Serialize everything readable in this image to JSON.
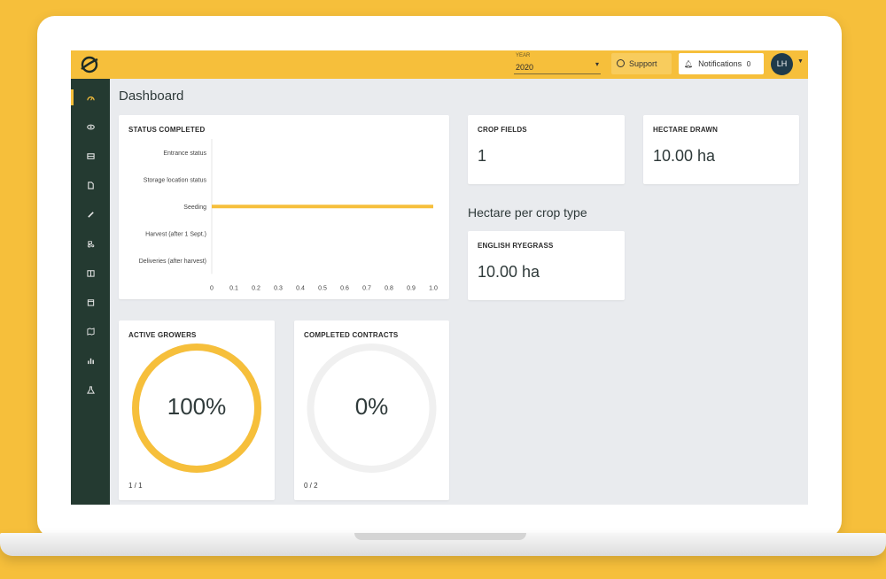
{
  "topbar": {
    "year_label": "YEAR",
    "year_value": "2020",
    "support_label": "Support",
    "notifications_label": "Notifications",
    "notifications_count": "0",
    "avatar_initials": "LH",
    "accent_color": "#f6bf3b"
  },
  "sidebar": {
    "items": [
      {
        "icon": "dashboard-icon"
      },
      {
        "icon": "eye-icon"
      },
      {
        "icon": "inbox-icon"
      },
      {
        "icon": "document-icon"
      },
      {
        "icon": "pencil-icon"
      },
      {
        "icon": "tractor-icon"
      },
      {
        "icon": "book-icon"
      },
      {
        "icon": "calendar-icon"
      },
      {
        "icon": "map-icon"
      },
      {
        "icon": "chart-icon"
      },
      {
        "icon": "flask-icon"
      }
    ],
    "background": "#243a31"
  },
  "page": {
    "title": "Dashboard",
    "hectare_per_crop_title": "Hectare per crop type"
  },
  "cards": {
    "crop_fields": {
      "title": "CROP FIELDS",
      "value": "1"
    },
    "hectare_drawn": {
      "title": "HECTARE DRAWN",
      "value": "10.00 ha"
    },
    "english_ryegrass": {
      "title": "ENGLISH RYEGRASS",
      "value": "10.00 ha"
    },
    "active_growers": {
      "title": "ACTIVE GROWERS",
      "percent_label": "100%",
      "fraction": "1 / 1",
      "ratio": 1.0
    },
    "completed_contracts": {
      "title": "COMPLETED CONTRACTS",
      "percent_label": "0%",
      "fraction": "0 / 2",
      "ratio": 0.0
    }
  },
  "chart_data": {
    "type": "bar",
    "title": "STATUS COMPLETED",
    "orientation": "horizontal",
    "categories": [
      "Entrance status",
      "Storage location status",
      "Seeding",
      "Harvest (after 1 Sept.)",
      "Deliveries (after harvest)"
    ],
    "values": [
      0,
      0,
      1.0,
      0,
      0
    ],
    "xlim": [
      0,
      1.0
    ],
    "x_ticks": [
      "0",
      "0.1",
      "0.2",
      "0.3",
      "0.4",
      "0.5",
      "0.6",
      "0.7",
      "0.8",
      "0.9",
      "1.0"
    ],
    "bar_color": "#f6bf3b",
    "grid": false
  }
}
